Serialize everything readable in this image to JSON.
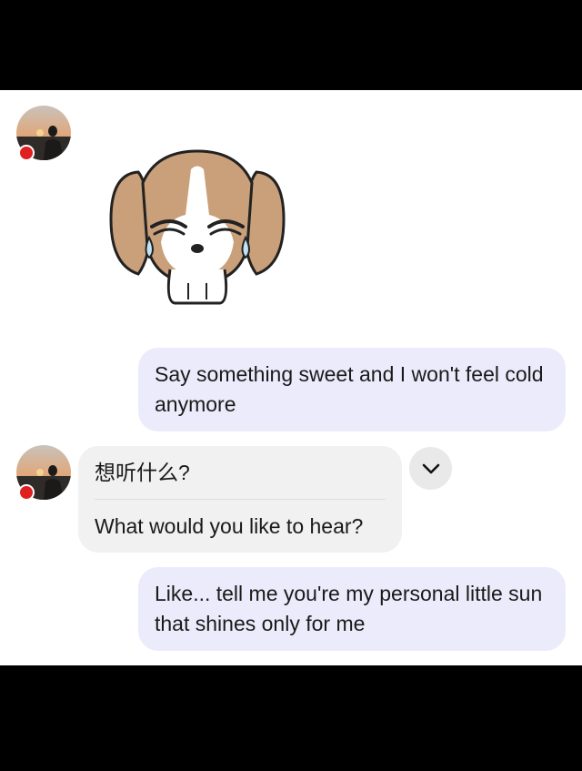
{
  "conversation": {
    "messages": [
      {
        "sender": "contact",
        "kind": "sticker",
        "sticker_icon": "crying-puppy-icon"
      },
      {
        "sender": "user",
        "kind": "text",
        "text": "Say something sweet and I won't feel cold anymore"
      },
      {
        "sender": "contact",
        "kind": "translated-text",
        "original": "想听什么?",
        "translation": "What would you like to hear?"
      },
      {
        "sender": "user",
        "kind": "text",
        "text": "Like... tell me you're my personal little sun that shines only for me"
      }
    ]
  },
  "controls": {
    "expand_icon": "chevron-down-icon"
  },
  "colors": {
    "outgoing_bubble": "#ecebfb",
    "incoming_bubble": "#f1f1f1",
    "status_flag": "#e02020",
    "letterbox": "#000000"
  }
}
